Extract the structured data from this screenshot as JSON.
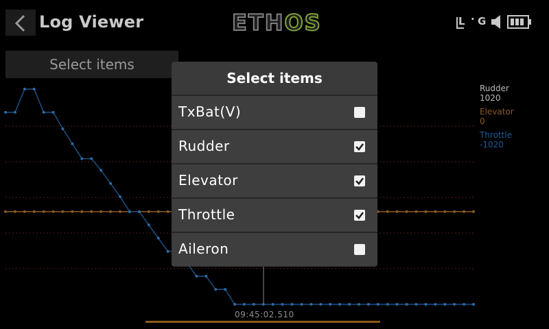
{
  "header": {
    "title": "Log Viewer",
    "brand_prefix": "ETH",
    "brand_suffix": "OS",
    "status_l": "L",
    "status_g": "G"
  },
  "select_button": {
    "label": "Select items"
  },
  "dialog": {
    "title": "Select items",
    "items": [
      {
        "label": "TxBat(V)",
        "checked": false
      },
      {
        "label": "Rudder",
        "checked": true
      },
      {
        "label": "Elevator",
        "checked": true
      },
      {
        "label": "Throttle",
        "checked": true
      },
      {
        "label": "Aileron",
        "checked": false
      }
    ]
  },
  "legend": {
    "items": [
      {
        "name": "Rudder",
        "value": "1020",
        "color": "#b8b8b8"
      },
      {
        "name": "Elevator",
        "value": "0",
        "color": "#8a5a22"
      },
      {
        "name": "Throttle",
        "value": "-1020",
        "color": "#1e5a96"
      }
    ]
  },
  "timeline": {
    "timestamp": "09:45:02.510"
  },
  "colors": {
    "accent": "#f0a020",
    "rudder": "#888888",
    "elevator": "#8a5a22",
    "throttle": "#2a6aa8"
  },
  "chart_data": {
    "type": "line",
    "series": [
      {
        "name": "Rudder",
        "values": [
          0,
          0,
          0,
          0,
          0,
          0,
          0,
          0,
          0,
          0,
          0,
          0,
          0,
          0,
          0,
          0,
          0,
          0,
          0,
          0,
          0,
          0,
          0,
          0,
          0,
          0,
          0,
          0,
          0,
          0,
          0,
          0,
          0,
          0,
          0,
          0,
          0,
          0,
          0,
          0,
          0,
          0,
          0,
          0,
          0,
          0,
          0,
          0,
          0,
          0
        ]
      },
      {
        "name": "Elevator",
        "values": [
          0,
          0,
          0,
          0,
          0,
          0,
          0,
          0,
          0,
          0,
          0,
          0,
          0,
          0,
          0,
          0,
          0,
          0,
          0,
          0,
          0,
          0,
          0,
          0,
          0,
          0,
          0,
          0,
          0,
          0,
          0,
          0,
          0,
          0,
          0,
          0,
          0,
          0,
          0,
          0,
          0,
          0,
          0,
          0,
          0,
          0,
          0,
          0,
          0,
          0
        ]
      },
      {
        "name": "Throttle",
        "values": [
          600,
          600,
          740,
          740,
          600,
          600,
          500,
          410,
          320,
          320,
          250,
          170,
          90,
          0,
          0,
          -80,
          -160,
          -240,
          -240,
          -310,
          -390,
          -390,
          -470,
          -470,
          -560,
          -560,
          -560,
          -560,
          -560,
          -560,
          -560,
          -560,
          -560,
          -560,
          -560,
          -560,
          -560,
          -560,
          -560,
          -560,
          -560,
          -560,
          -560,
          -560,
          -560,
          -560,
          -560,
          -560,
          -560,
          -560
        ]
      }
    ]
  }
}
